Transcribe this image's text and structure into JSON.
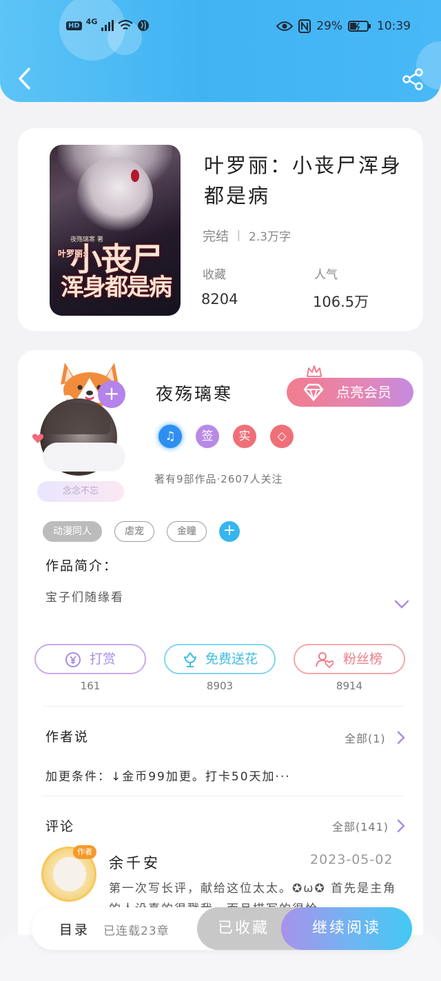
{
  "status_bar": {
    "hd_label": "HD",
    "network": "4G",
    "battery_percent": "29%",
    "time": "10:39"
  },
  "book": {
    "title": "叶罗丽：小丧尸浑身都是病",
    "status": "完结",
    "word_count": "2.3万字",
    "favorites_label": "收藏",
    "favorites_value": "8204",
    "popularity_label": "人气",
    "popularity_value": "106.5万",
    "cover": {
      "author_line": "夜殇璃寒 著",
      "series": "叶罗丽:",
      "title_line1": "小丧尸",
      "title_line2": "浑身都是病"
    }
  },
  "author": {
    "name": "夜殇璃寒",
    "name_tag": "念念不忘",
    "vip_button": "点亮会员",
    "badges": [
      {
        "name": "music-badge",
        "text": "♫",
        "color": "#2f8ff0"
      },
      {
        "name": "sign-badge",
        "text": "签",
        "color": "#b88ae6"
      },
      {
        "name": "real-badge",
        "text": "实",
        "color": "#ef6f78"
      },
      {
        "name": "diamond-badge",
        "text": "◇",
        "color": "#ef6f78"
      }
    ],
    "follow_info": "著有9部作品·2607人关注"
  },
  "tags": [
    {
      "label": "动漫同人",
      "style": "filled"
    },
    {
      "label": "虐宠",
      "style": "outline"
    },
    {
      "label": "金瞳",
      "style": "outline"
    }
  ],
  "intro": {
    "label": "作品简介：",
    "text": "宝子们随缘看"
  },
  "actions": [
    {
      "label": "打赏",
      "count": "161",
      "color": "#b68ae6"
    },
    {
      "label": "免费送花",
      "count": "8903",
      "color": "#4cc6ea"
    },
    {
      "label": "粉丝榜",
      "count": "8914",
      "color": "#ee7d86"
    }
  ],
  "author_says": {
    "label": "作者说",
    "more": "全部(1)",
    "text": "加更条件：↓金币99加更。打卡50天加···"
  },
  "comments": {
    "label": "评论",
    "more": "全部(141)",
    "items": [
      {
        "badge": "作者",
        "user": "余千安",
        "date": "2023-05-02",
        "text": "第一次写长评，献给这位太太。✪ω✪ 首先是主角的人设真的很戳我，而且描写的很恰"
      }
    ]
  },
  "bottom_bar": {
    "toc": "目录",
    "serial": "已连载23章",
    "collected": "已收藏",
    "continue": "继续阅读"
  },
  "colors": {
    "header_blue": "#45b6f4",
    "accent_purple": "#b484ea",
    "accent_pink": "#f27c8e"
  }
}
